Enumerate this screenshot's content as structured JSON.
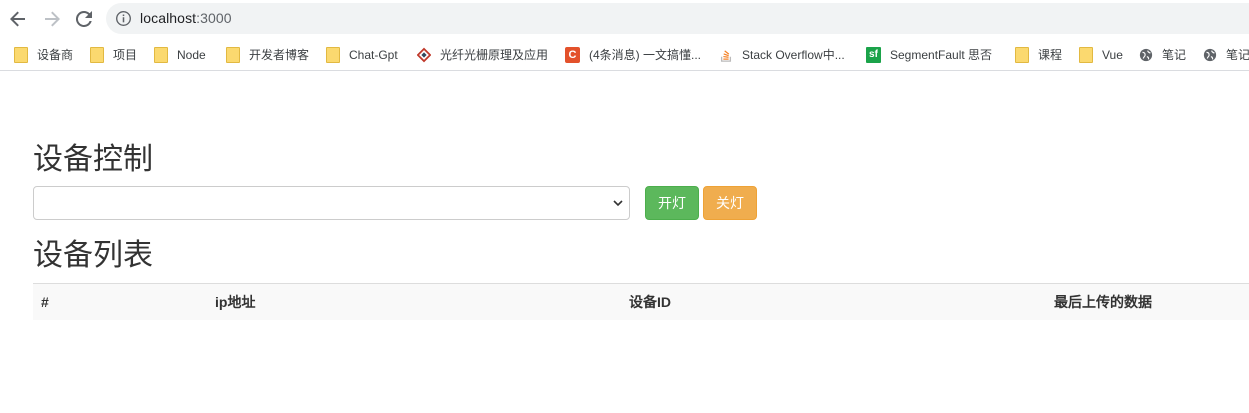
{
  "browser": {
    "url_host": "localhost",
    "url_port": ":3000",
    "nav_icons": [
      "back-arrow-icon",
      "forward-arrow-icon",
      "reload-icon",
      "info-icon"
    ]
  },
  "bookmarks": [
    {
      "label": "设备商",
      "icon": "folder-icon"
    },
    {
      "label": "项目",
      "icon": "folder-icon"
    },
    {
      "label": "Node",
      "icon": "folder-icon"
    },
    {
      "label": "开发者博客",
      "icon": "folder-icon"
    },
    {
      "label": "Chat-Gpt",
      "icon": "folder-icon"
    },
    {
      "label": "光纤光栅原理及应用",
      "icon": "diamond-site-icon"
    },
    {
      "label": "(4条消息) 一文搞懂...",
      "icon": "csdn-icon",
      "icon_text": "C"
    },
    {
      "label": "Stack Overflow中...",
      "icon": "stackoverflow-icon"
    },
    {
      "label": "SegmentFault 思否",
      "icon": "segmentfault-icon",
      "icon_text": "sf"
    },
    {
      "label": "课程",
      "icon": "folder-icon"
    },
    {
      "label": "Vue",
      "icon": "folder-icon"
    },
    {
      "label": "笔记",
      "icon": "globe-icon"
    },
    {
      "label": "笔记",
      "icon": "globe-icon"
    }
  ],
  "page": {
    "control_heading": "设备控制",
    "device_select_value": "",
    "button_on": "开灯",
    "button_off": "关灯",
    "list_heading": "设备列表",
    "table_headers": [
      "#",
      "ip地址",
      "设备ID",
      "最后上传的数据"
    ]
  },
  "colors": {
    "button_on": "#5cb85c",
    "button_off": "#f0ad4e",
    "table_header_bg": "#f9f9f9"
  }
}
